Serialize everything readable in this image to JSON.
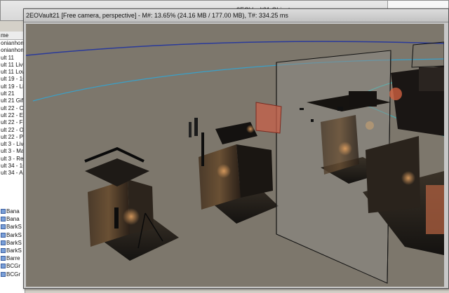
{
  "background_window": {
    "title": "2EOVault21 Objects"
  },
  "left_list": {
    "header": "me",
    "items": [
      "onianhom",
      "onianhom",
      "ult 11",
      "ult 11 Livi",
      "ult 11 Low",
      "ult 19 - 1s",
      "ult 19 - Liv",
      "ult 21",
      "ult 21 Gift",
      "ult 22 - Co",
      "ult 22 - En",
      "ult 22 - Fo",
      "ult 22 - Ox",
      "ult 22 - Pe",
      "ult 3 - Livi",
      "ult 3 - Mar",
      "ult 3 - Red",
      "ult 34 - 1s",
      "ult 34 - An"
    ]
  },
  "object_list": {
    "items": [
      "Bana",
      "Bana",
      "BarkS",
      "BarkS",
      "BarkS",
      "BarkS",
      "Barre",
      "BCGr",
      "BCGr"
    ]
  },
  "viewport": {
    "title": "2EOVault21 [Free camera, perspective] - M#: 13.65% (24.16 MB / 177.00 MB), T#: 334.25 ms"
  },
  "colors": {
    "viewport_bg": "#7d776c",
    "spline_blue": "#2a3a9a",
    "spline_cyan": "#3aa0c8",
    "selection_red": "#c85040"
  }
}
